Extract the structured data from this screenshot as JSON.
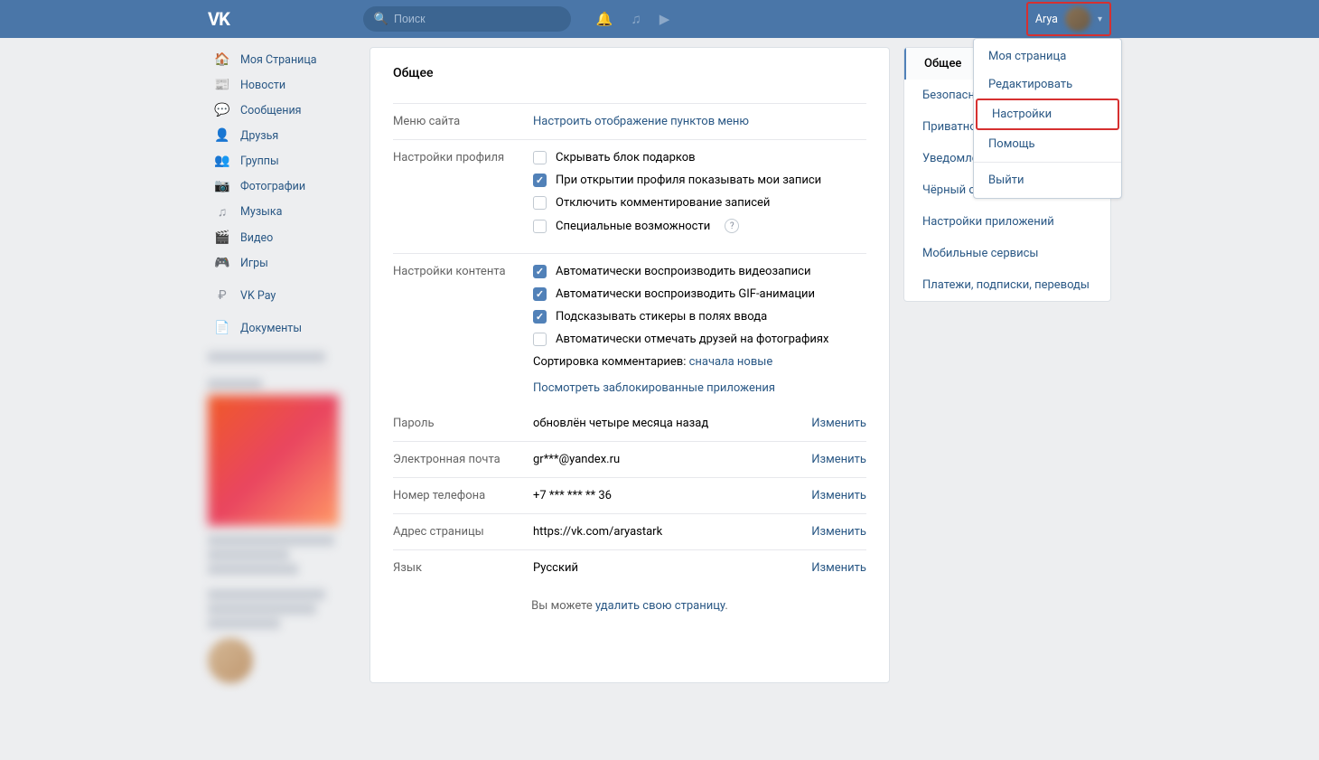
{
  "header": {
    "search_placeholder": "Поиск",
    "username": "Arya"
  },
  "nav": {
    "items": [
      {
        "label": "Моя Страница",
        "icon": "🏠"
      },
      {
        "label": "Новости",
        "icon": "📰"
      },
      {
        "label": "Сообщения",
        "icon": "💬"
      },
      {
        "label": "Друзья",
        "icon": "👤"
      },
      {
        "label": "Группы",
        "icon": "👥"
      },
      {
        "label": "Фотографии",
        "icon": "📷"
      },
      {
        "label": "Музыка",
        "icon": "♫"
      },
      {
        "label": "Видео",
        "icon": "🎬"
      },
      {
        "label": "Игры",
        "icon": "🎮"
      }
    ],
    "vkpay": "VK Pay",
    "documents": "Документы"
  },
  "main": {
    "title": "Общее",
    "menu_section": {
      "label": "Меню сайта",
      "link": "Настроить отображение пунктов меню"
    },
    "profile_section": {
      "label": "Настройки профиля",
      "options": [
        {
          "text": "Скрывать блок подарков",
          "checked": false
        },
        {
          "text": "При открытии профиля показывать мои записи",
          "checked": true
        },
        {
          "text": "Отключить комментирование записей",
          "checked": false
        },
        {
          "text": "Специальные возможности",
          "checked": false,
          "help": true
        }
      ]
    },
    "content_section": {
      "label": "Настройки контента",
      "options": [
        {
          "text": "Автоматически воспроизводить видеозаписи",
          "checked": true
        },
        {
          "text": "Автоматически воспроизводить GIF-анимации",
          "checked": true
        },
        {
          "text": "Подсказывать стикеры в полях ввода",
          "checked": true
        },
        {
          "text": "Автоматически отмечать друзей на фотографиях",
          "checked": false
        }
      ],
      "sort_label": "Сортировка комментариев: ",
      "sort_value": "сначала новые",
      "blocked_link": "Посмотреть заблокированные приложения"
    },
    "rows": [
      {
        "label": "Пароль",
        "value": "обновлён четыре месяца назад",
        "action": "Изменить"
      },
      {
        "label": "Электронная почта",
        "value": "gr***@yandex.ru",
        "action": "Изменить"
      },
      {
        "label": "Номер телефона",
        "value": "+7 *** *** ** 36",
        "action": "Изменить"
      },
      {
        "label": "Адрес страницы",
        "value": "https://vk.com/aryastark",
        "action": "Изменить"
      },
      {
        "label": "Язык",
        "value": "Русский",
        "action": "Изменить"
      }
    ],
    "footer_prefix": "Вы можете ",
    "footer_link": "удалить свою страницу",
    "footer_suffix": "."
  },
  "side": {
    "items": [
      {
        "label": "Общее",
        "active": true
      },
      {
        "label": "Безопасность"
      },
      {
        "label": "Приватность"
      },
      {
        "label": "Уведомления"
      },
      {
        "label": "Чёрный список"
      },
      {
        "label": "Настройки приложений"
      },
      {
        "label": "Мобильные сервисы"
      },
      {
        "label": "Платежи, подписки, переводы"
      }
    ]
  },
  "dropdown": {
    "items": [
      {
        "label": "Моя страница"
      },
      {
        "label": "Редактировать"
      },
      {
        "label": "Настройки",
        "highlighted": true
      },
      {
        "label": "Помощь"
      },
      {
        "label": "Выйти",
        "divider_before": true
      }
    ]
  }
}
